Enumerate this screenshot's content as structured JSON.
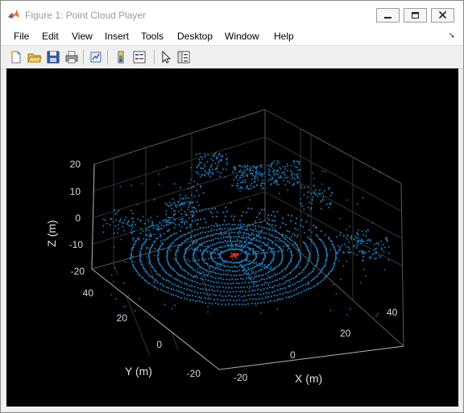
{
  "window": {
    "title": "Figure 1: Point Cloud Player"
  },
  "menu": [
    "File",
    "Edit",
    "View",
    "Insert",
    "Tools",
    "Desktop",
    "Window",
    "Help"
  ],
  "toolbar_icons": [
    "new-file-icon",
    "open-folder-icon",
    "save-icon",
    "print-icon",
    "link-plot-icon",
    "colorbar-icon",
    "legend-icon",
    "pointer-icon",
    "property-inspector-icon"
  ],
  "plot": {
    "xlabel": "X (m)",
    "ylabel": "Y (m)",
    "zlabel": "Z (m)",
    "z_ticks": [
      "20",
      "10",
      "0",
      "-10",
      "-20"
    ],
    "y_ticks": [
      "40",
      "20",
      "0",
      "-20"
    ],
    "x_ticks": [
      "-20",
      "0",
      "20",
      "40"
    ],
    "point_color": "#1f77b4",
    "highlight_color": "#d62728",
    "background": "#000000"
  }
}
